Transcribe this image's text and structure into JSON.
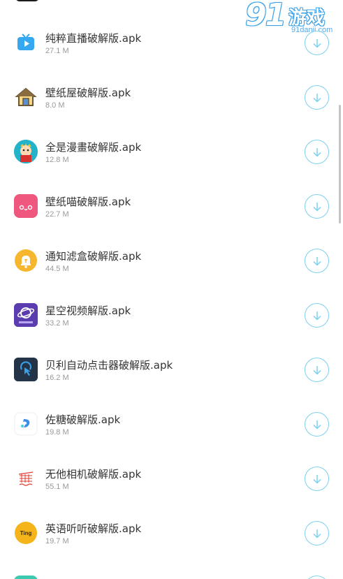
{
  "watermark": {
    "number": "91",
    "text": "游戏",
    "url": "91danji.com"
  },
  "apps": [
    {
      "name": "纯粹直播破解版.apk",
      "size": "27.1 M",
      "icon": "tv-icon",
      "color": "#35a8f0"
    },
    {
      "name": "壁纸屋破解版.apk",
      "size": "8.0 M",
      "icon": "house-icon",
      "color": "#8a6a3a"
    },
    {
      "name": "全是漫畫破解版.apk",
      "size": "12.8 M",
      "icon": "comic-character-icon",
      "color": "#22b3c9"
    },
    {
      "name": "壁纸喵破解版.apk",
      "size": "22.7 M",
      "icon": "cat-face-icon",
      "color": "#f0577e"
    },
    {
      "name": "通知滤盒破解版.apk",
      "size": "44.5 M",
      "icon": "bell-icon",
      "color": "#f6b72e"
    },
    {
      "name": "星空视频解版.apk",
      "size": "33.2 M",
      "icon": "planet-icon",
      "color": "#5b3db0"
    },
    {
      "name": "贝利自动点击器破解版.apk",
      "size": "16.2 M",
      "icon": "tap-finger-icon",
      "color": "#243448"
    },
    {
      "name": "佐糖破解版.apk",
      "size": "19.8 M",
      "icon": "sugar-icon",
      "color": "#3c8ee8"
    },
    {
      "name": "无他相机破解版.apk",
      "size": "55.1 M",
      "icon": "camera-grid-icon",
      "color": "#e0392f"
    },
    {
      "name": "英语听听破解版.apk",
      "size": "19.7 M",
      "icon": "tingting-icon",
      "color": "#f4b41a"
    }
  ],
  "partial_app": {
    "icon": "partial-app-icon",
    "color": "#3ccab0"
  },
  "accent": "#7cd0ef"
}
